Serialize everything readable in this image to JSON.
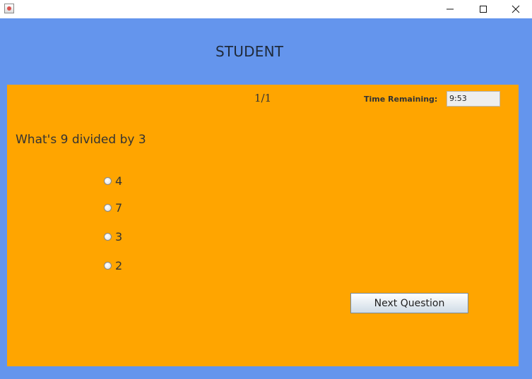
{
  "window": {
    "icon": "java-app-icon",
    "controls": {
      "minimize_icon": "minimize-icon",
      "maximize_icon": "maximize-icon",
      "close_icon": "close-icon"
    }
  },
  "header": {
    "title": "STUDENT"
  },
  "quiz": {
    "counter": "1/1",
    "time_label": "Time Remaining:",
    "time_value": "9:53",
    "question": "What's 9 divided by 3",
    "options": [
      "4",
      "7",
      "3",
      "2"
    ],
    "next_label": "Next Question"
  },
  "colors": {
    "background": "#6495ED",
    "panel": "#FFA500"
  }
}
